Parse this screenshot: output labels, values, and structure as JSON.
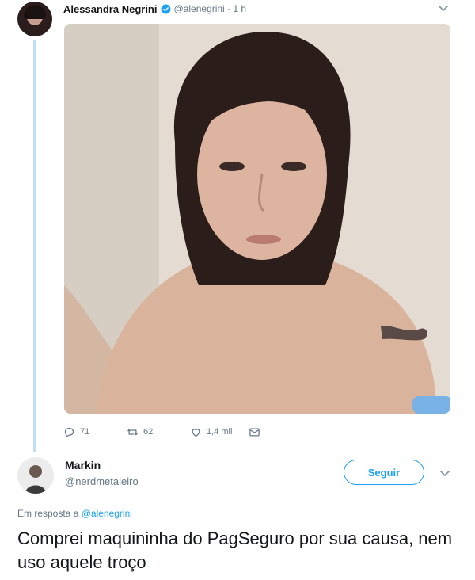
{
  "tweet": {
    "author_name": "Alessandra Negrini",
    "handle_time": "@alenegrini · 1 h",
    "replies": "71",
    "retweets": "62",
    "likes": "1,4 mil"
  },
  "reply": {
    "author_name": "Markin",
    "handle": "@nerdmetaleiro",
    "follow_label": "Seguir",
    "reply_prefix": "Em resposta a",
    "reply_mention": "@alenegrini",
    "text": "Comprei maquininha do PagSeguro por sua causa, nem uso aquele troço"
  },
  "colors": {
    "accent": "#1da1f2",
    "thread_line": "#c4e0f6",
    "muted": "#657786"
  },
  "icons": [
    "verified-badge-icon",
    "chevron-down-icon",
    "reply-icon",
    "retweet-icon",
    "like-icon",
    "message-icon"
  ]
}
